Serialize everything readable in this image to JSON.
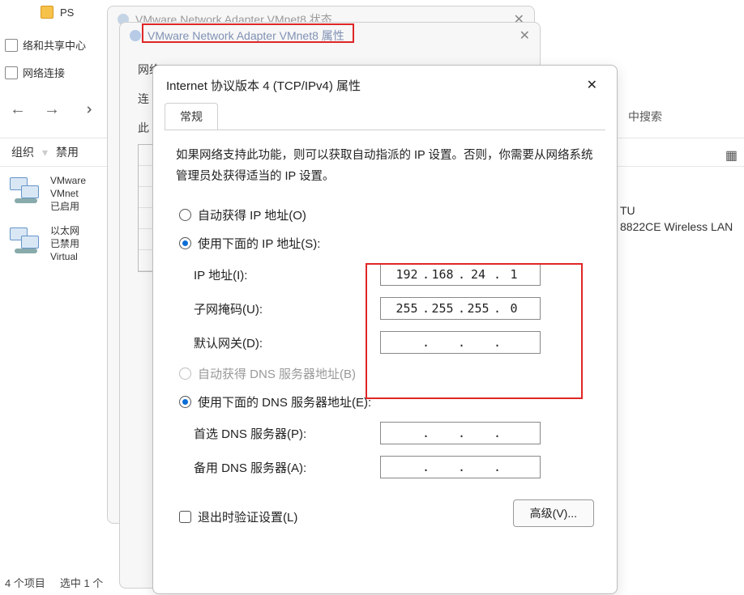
{
  "explorer": {
    "folder_label": "PS",
    "side1": "络和共享中心",
    "side2": "网络连接",
    "org_label": "组织",
    "disable_label": "禁用",
    "search_fragment": "中搜索",
    "status_items": "4 个项目",
    "status_selected": "选中 1 个"
  },
  "net_items": [
    {
      "name": "VMware",
      "line2": "VMnet",
      "line3": "已启用"
    },
    {
      "name": "以太网",
      "line2": "已禁用",
      "line3": "Virtual"
    }
  ],
  "peek": {
    "line1": "TU",
    "line2": "8822CE Wireless LAN"
  },
  "dlg1": {
    "title": "VMware Network Adapter VMnet8 状态"
  },
  "dlg2": {
    "title": "VMware Network Adapter VMnet8 属性",
    "line1": "网络",
    "line2": "连",
    "line3": "此"
  },
  "dlg3": {
    "title": "Internet 协议版本 4 (TCP/IPv4) 属性",
    "tab": "常规",
    "desc": "如果网络支持此功能，则可以获取自动指派的 IP 设置。否则，你需要从网络系统管理员处获得适当的 IP 设置。",
    "radio_auto_ip": "自动获得 IP 地址(O)",
    "radio_manual_ip": "使用下面的 IP 地址(S):",
    "label_ip": "IP 地址(I):",
    "label_mask": "子网掩码(U):",
    "label_gw": "默认网关(D):",
    "ip": {
      "a": "192",
      "b": "168",
      "c": "24",
      "d": "1"
    },
    "mask": {
      "a": "255",
      "b": "255",
      "c": "255",
      "d": "0"
    },
    "radio_auto_dns": "自动获得 DNS 服务器地址(B)",
    "radio_manual_dns": "使用下面的 DNS 服务器地址(E):",
    "label_dns1": "首选 DNS 服务器(P):",
    "label_dns2": "备用 DNS 服务器(A):",
    "chk_validate": "退出时验证设置(L)",
    "btn_advanced": "高级(V)..."
  }
}
